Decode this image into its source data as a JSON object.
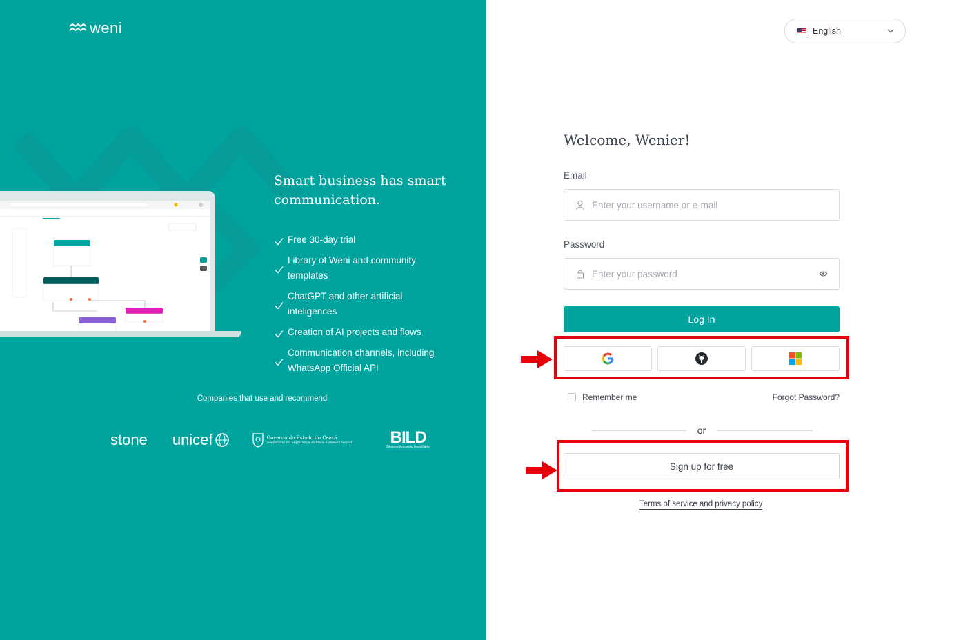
{
  "brand": {
    "logo_text": "weni"
  },
  "promo": {
    "tagline": "Smart business has smart communication.",
    "features": [
      "Free 30-day trial",
      "Library of Weni and community templates",
      "ChatGPT and other artificial inteligences",
      "Creation of AI projects and flows",
      "Communication channels, including WhatsApp Official API"
    ],
    "companies_title": "Companies that use and recommend",
    "partners": {
      "stone": "stone",
      "unicef": "unicef",
      "gov": "Governo do Estado do Ceará",
      "gov_sub": "Secretaria da Segurança Pública e Defesa Social",
      "bild": "BILD",
      "bild_sub": "Desenvolvimento Imobiliário"
    }
  },
  "language": {
    "selected": "English"
  },
  "form": {
    "welcome": "Welcome, Wenier!",
    "email_label": "Email",
    "email_placeholder": "Enter your username or e-mail",
    "password_label": "Password",
    "password_placeholder": "Enter your password",
    "login_label": "Log In",
    "social": [
      "google-icon",
      "github-icon",
      "microsoft-icon"
    ],
    "remember_label": "Remember me",
    "forgot_label": "Forgot Password?",
    "or_label": "or",
    "signup_label": "Sign up for free",
    "terms_label": "Terms of service and privacy policy"
  },
  "colors": {
    "brand": "#00A49F",
    "highlight": "#E5000A"
  }
}
